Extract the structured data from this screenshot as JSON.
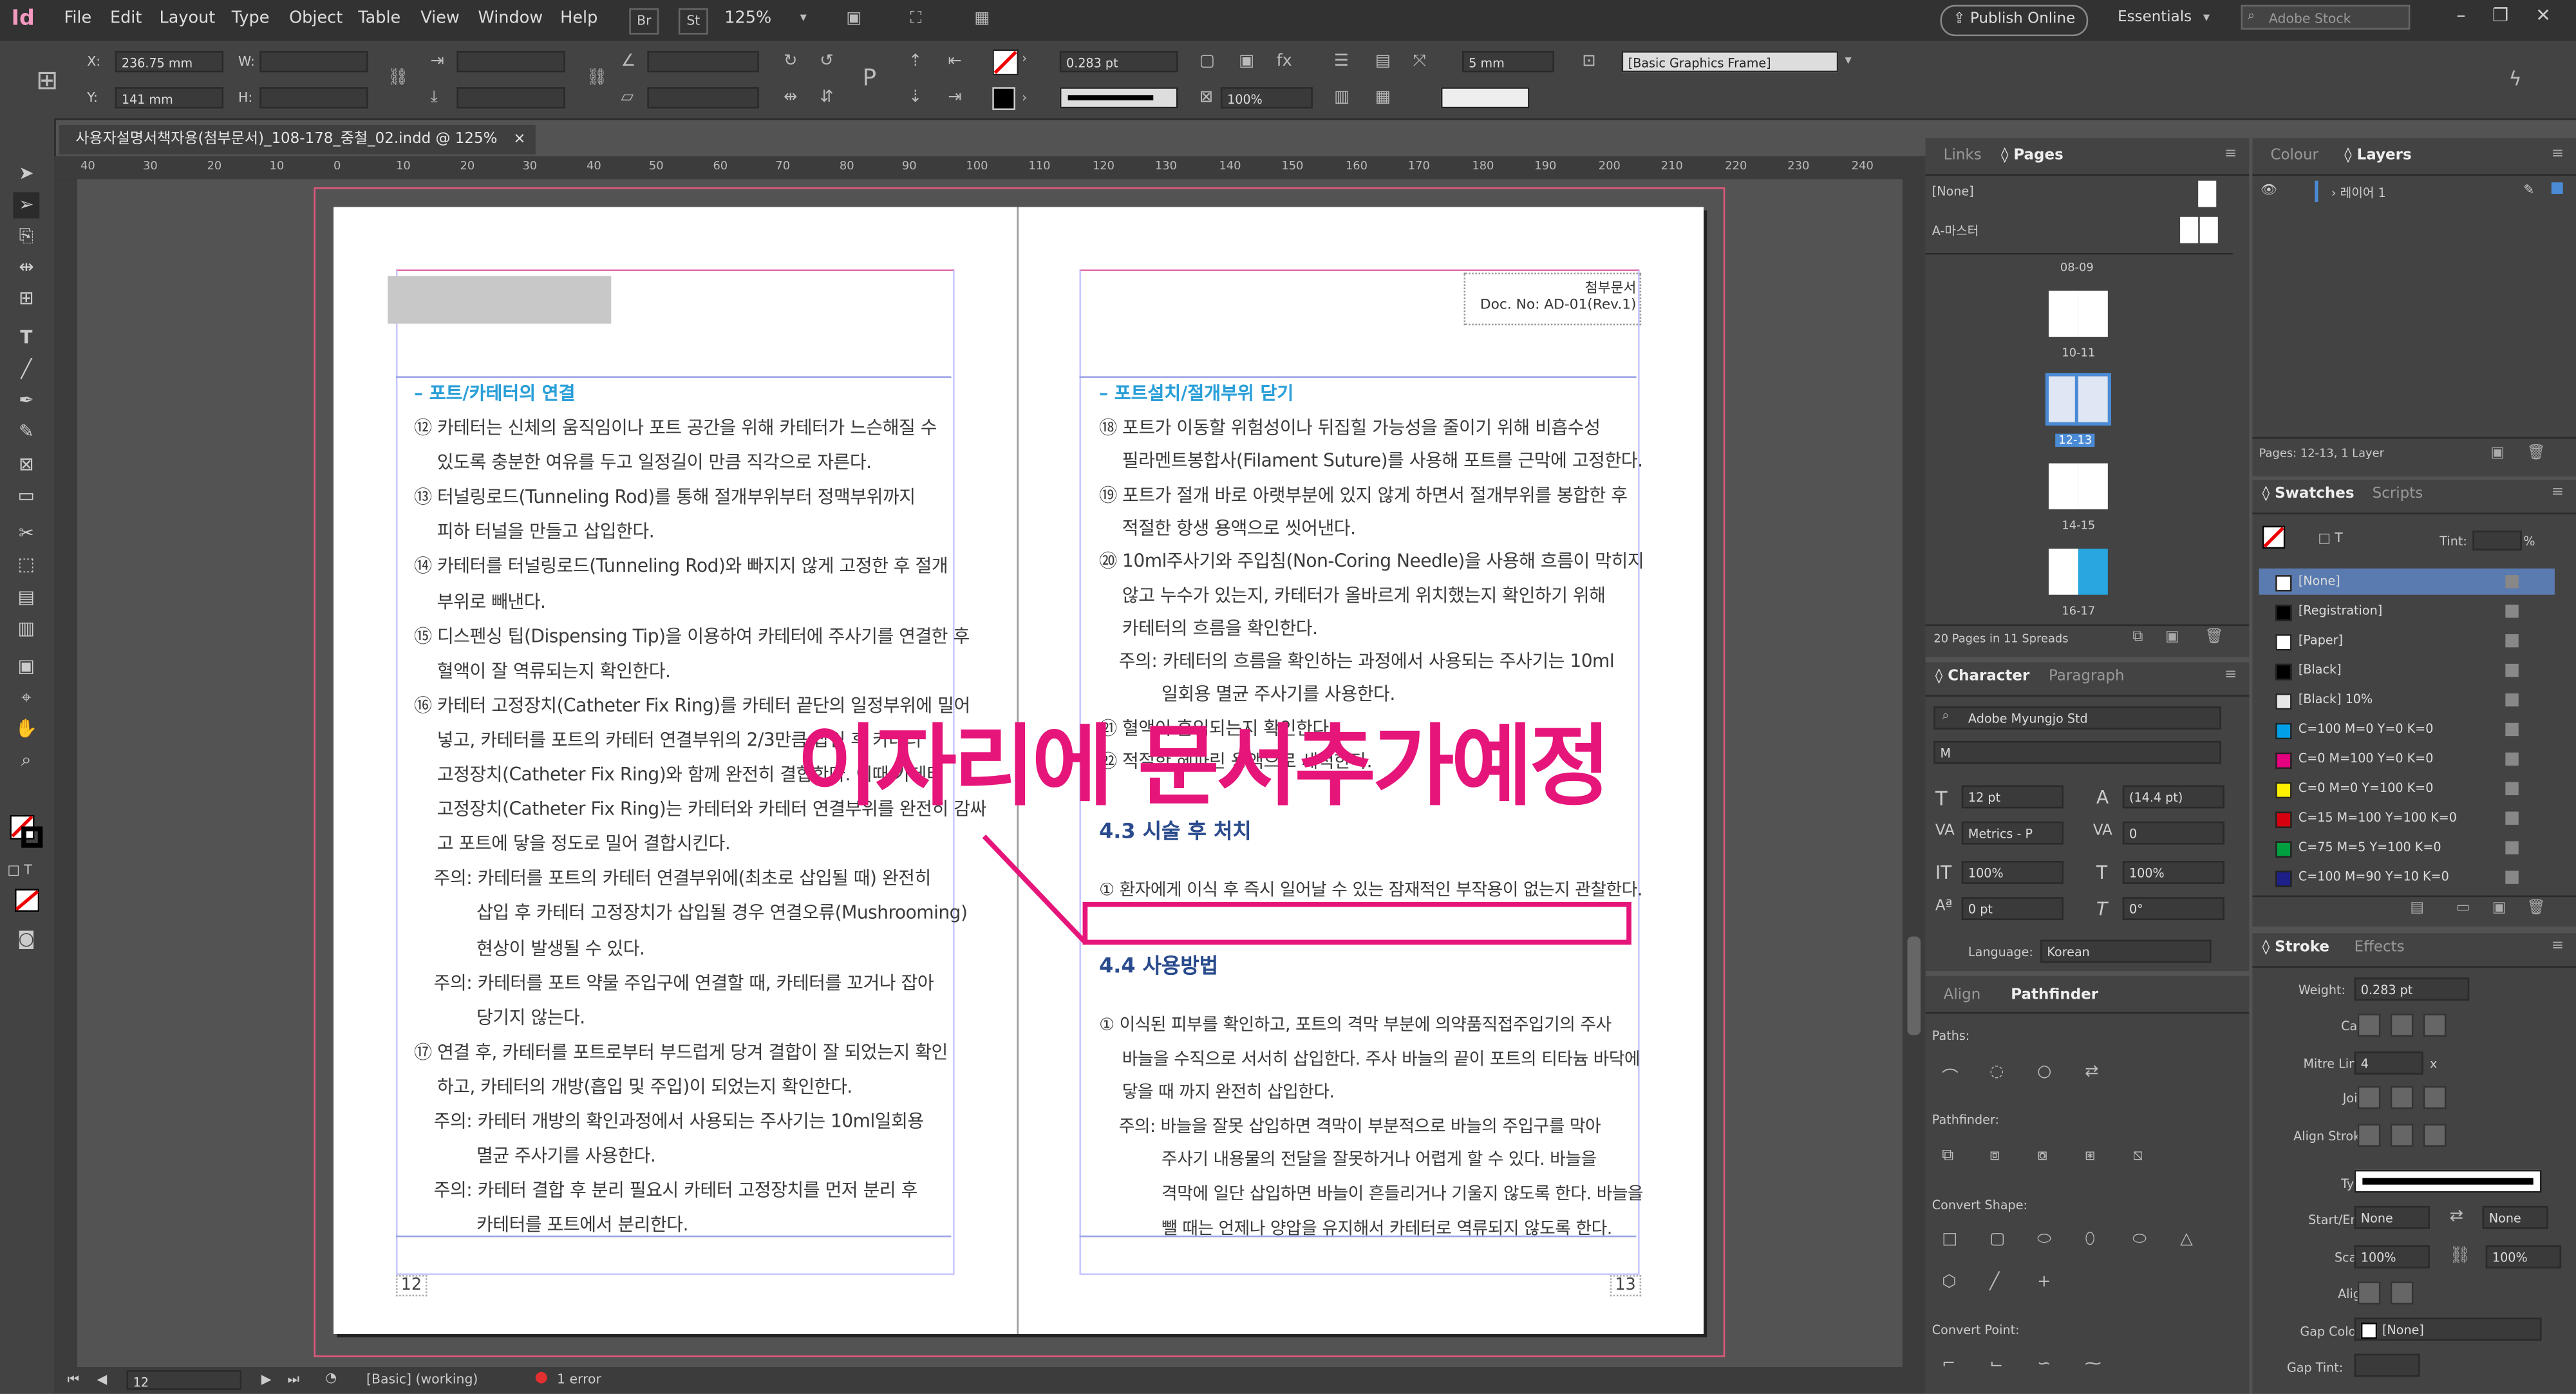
{
  "app": {
    "logo": "Id"
  },
  "menu": [
    "File",
    "Edit",
    "Layout",
    "Type",
    "Object",
    "Table",
    "View",
    "Window",
    "Help"
  ],
  "header_controls": {
    "br": "Br",
    "st": "St",
    "zoom": "125%",
    "publish": "Publish Online",
    "workspace": "Essentials",
    "stock_placeholder": "Adobe Stock"
  },
  "control_bar": {
    "x_label": "X:",
    "x_value": "236.75 mm",
    "y_label": "Y:",
    "y_value": "141 mm",
    "w_label": "W:",
    "h_label": "H:",
    "stroke_weight": "0.283 pt",
    "gap": "5 mm",
    "scale": "100%",
    "object_style": "[Basic Graphics Frame]"
  },
  "document_tab": {
    "title": "사용자설명서책자용(첨부문서)_108-178_중철_02.indd @ 125%",
    "close": "×"
  },
  "ruler": {
    "top": [
      "40",
      "30",
      "20",
      "10",
      "0",
      "10",
      "20",
      "30",
      "40",
      "50",
      "60",
      "70",
      "80",
      "90",
      "100",
      "110",
      "120",
      "130",
      "140",
      "150",
      "160",
      "170",
      "180",
      "190",
      "200",
      "210",
      "220",
      "230",
      "240"
    ]
  },
  "left_page": {
    "heading": "– 포트/카테터의 연결",
    "lines": [
      "⑫ 카테터는 신체의 움직임이나 포트 공간을 위해 카테터가 느슨해질 수",
      "있도록 충분한 여유를 두고 일정길이 만큼 직각으로 자른다.",
      "⑬ 터널링로드(Tunneling Rod)를 통해 절개부위부터 정맥부위까지",
      "피하 터널을 만들고 삽입한다.",
      "⑭ 카테터를 터널링로드(Tunneling Rod)와 빠지지 않게 고정한 후 절개",
      "부위로 빼낸다.",
      "⑮ 디스펜싱 팁(Dispensing Tip)을 이용하여 카테터에 주사기를 연결한 후",
      "혈액이 잘 역류되는지 확인한다.",
      "⑯ 카테터 고정장치(Catheter Fix Ring)를 카테터 끝단의 일정부위에 밀어",
      "넣고, 카테터를 포트의 카테터 연결부위의 2/3만큼 삽입 후 카테터",
      "고정장치(Catheter Fix Ring)와 함께 완전히 결합한다. 이때 카테터",
      "고정장치(Catheter Fix Ring)는 카테터와 카테터 연결부위를 완전히 감싸",
      "고 포트에 닿을 정도로 밀어 결합시킨다.",
      "주의: 카테터를 포트의 카테터 연결부위에(최초로 삽입될 때) 완전히",
      "삽입 후 카테터 고정장치가 삽입될 경우 연결오류(Mushrooming)",
      "현상이 발생될 수 있다.",
      "주의: 카테터를 포트 약물 주입구에 연결할 때, 카테터를 꼬거나 잡아",
      "당기지 않는다.",
      "⑰ 연결 후, 카테터를 포트로부터 부드럽게 당겨 결합이 잘 되었는지 확인",
      "하고, 카테터의 개방(흡입 및 주입)이 되었는지 확인한다.",
      "주의: 카테터 개방의 확인과정에서 사용되는 주사기는 10ml일회용",
      "멸균 주사기를 사용한다.",
      "주의: 카테터 결합 후 분리 필요시 카테터 고정장치를 먼저 분리 후",
      "카테터를 포트에서 분리한다."
    ],
    "page_number": "12"
  },
  "right_page": {
    "doc_label_1": "첨부문서",
    "doc_label_2": "Doc. No: AD-01(Rev.1)",
    "heading": "– 포트설치/절개부위 닫기",
    "lines_a": [
      "⑱ 포트가 이동할 위험성이나 뒤집힐 가능성을 줄이기 위해 비흡수성",
      "필라멘트봉합사(Filament Suture)를 사용해 포트를 근막에 고정한다.",
      "⑲ 포트가 절개 바로 아랫부분에 있지 않게 하면서 절개부위를 봉합한 후",
      "적절한 항생 용액으로 씻어낸다.",
      "⑳ 10ml주사기와 주입침(Non-Coring Needle)을 사용해 흐름이 막히지",
      "않고 누수가 있는지, 카테터가 올바르게 위치했는지 확인하기 위해",
      "카테터의 흐름을 확인한다.",
      "주의: 카테터의 흐름을 확인하는 과정에서 사용되는 주사기는 10ml",
      "일회용 멸균 주사기를 사용한다.",
      "㉑ 혈액이 흡입되는지 확인한다.",
      "㉒ 적절한 헤파린 용액으로 세척한다."
    ],
    "section_43": "4.3 시술 후 처치",
    "line_43": "① 환자에게 이식 후 즉시 일어날 수 있는 잠재적인 부작용이 없는지 관찰한다.",
    "section_44": "4.4 사용방법",
    "lines_b": [
      "① 이식된 피부를 확인하고, 포트의 격막 부분에 의약품직접주입기의 주사",
      "바늘을 수직으로 서서히 삽입한다. 주사 바늘의 끝이 포트의 티타늄 바닥에",
      "닿을 때 까지 완전히 삽입한다.",
      "주의: 바늘을 잘못 삽입하면 격막이 부분적으로 바늘의 주입구를 막아",
      "주사기 내용물의 전달을 잘못하거나 어렵게 할 수 있다. 바늘을",
      "격막에 일단 삽입하면 바늘이 흔들리거나 기울지 않도록 한다. 바늘을",
      "뺄 때는 언제나 양압을 유지해서 카테터로 역류되지 않도록 한다."
    ],
    "page_number": "13"
  },
  "annotation": {
    "text": "이자리에 문서추가예정"
  },
  "status_bar": {
    "page": "12",
    "preflight": "[Basic] (working)",
    "errors": "1 error"
  },
  "panels": {
    "links_tab": "Links",
    "pages_tab": "Pages",
    "pages_none": "[None]",
    "pages_master": "A-마스터",
    "thumbs": [
      "08-09",
      "10-11",
      "12-13",
      "14-15",
      "16-17"
    ],
    "pages_info": "20 Pages in 11 Spreads",
    "colour_tab": "Colour",
    "layers_tab": "Layers",
    "layer_name": "레이어 1",
    "layers_info": "Pages: 12-13, 1 Layer",
    "swatches_tab": "Swatches",
    "scripts_tab": "Scripts",
    "tint_label": "Tint:",
    "tint_unit": "%",
    "swatches": [
      {
        "name": "[None]",
        "color": "#ffffff"
      },
      {
        "name": "[Registration]",
        "color": "#000000"
      },
      {
        "name": "[Paper]",
        "color": "#ffffff"
      },
      {
        "name": "[Black]",
        "color": "#000000"
      },
      {
        "name": "[Black] 10%",
        "color": "#e6e6e6"
      },
      {
        "name": "C=100 M=0 Y=0 K=0",
        "color": "#00a0e9"
      },
      {
        "name": "C=0 M=100 Y=0 K=0",
        "color": "#e4007f"
      },
      {
        "name": "C=0 M=0 Y=100 K=0",
        "color": "#fff100"
      },
      {
        "name": "C=15 M=100 Y=100 K=0",
        "color": "#d7000f"
      },
      {
        "name": "C=75 M=5 Y=100 K=0",
        "color": "#00a040"
      },
      {
        "name": "C=100 M=90 Y=10 K=0",
        "color": "#1d2088"
      }
    ],
    "character_tab": "Character",
    "paragraph_tab": "Paragraph",
    "font_family": "Adobe Myungjo Std",
    "font_style": "M",
    "font_size": "12 pt",
    "leading": "(14.4 pt)",
    "kerning": "Metrics - P",
    "tracking": "0",
    "vscale": "100%",
    "hscale": "100%",
    "baseline": "0 pt",
    "skew": "0°",
    "language_label": "Language:",
    "language": "Korean",
    "align_tab": "Align",
    "pathfinder_tab": "Pathfinder",
    "paths_label": "Paths:",
    "pathfinder_label": "Pathfinder:",
    "convert_shape_label": "Convert Shape:",
    "convert_point_label": "Convert Point:",
    "stroke_tab": "Stroke",
    "effects_tab": "Effects",
    "weight_label": "Weight:",
    "weight": "0.283 pt",
    "cap_label": "Cap:",
    "mitre_label": "Mitre Limit:",
    "mitre": "4",
    "join_label": "Join:",
    "align_stroke_label": "Align Stroke:",
    "type_label": "Type:",
    "startend_label": "Start/End:",
    "start": "None",
    "end": "None",
    "scale_label": "Scale:",
    "scale_start": "100%",
    "scale_end": "100%",
    "align_label": "Align:",
    "gap_colour_label": "Gap Colour:",
    "gap_colour": "[None]",
    "gap_tint_label": "Gap Tint:"
  }
}
